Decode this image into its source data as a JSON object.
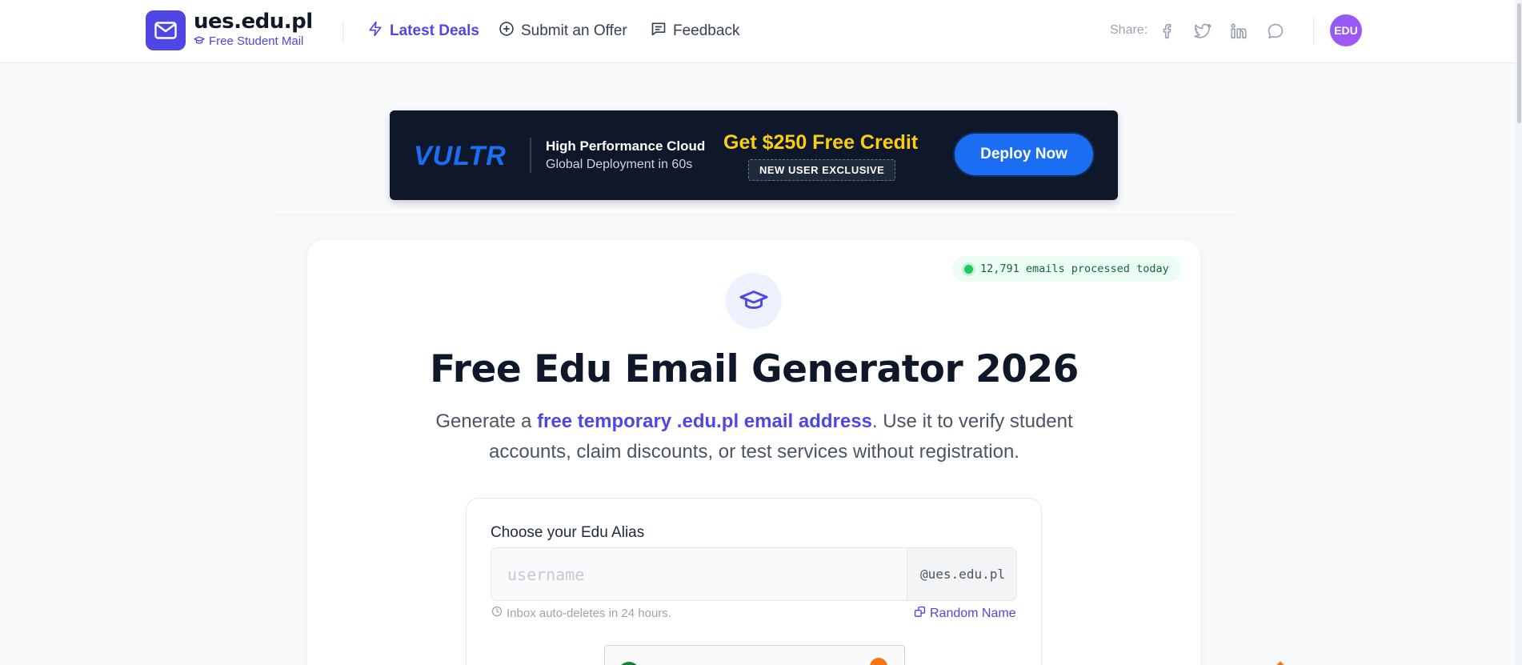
{
  "header": {
    "brand_title": "ues.edu.pl",
    "brand_subtitle": "Free Student Mail",
    "nav": [
      {
        "label": "Latest Deals",
        "icon": "lightning-icon",
        "active": true
      },
      {
        "label": "Submit an Offer",
        "icon": "plus-circle-icon",
        "active": false
      },
      {
        "label": "Feedback",
        "icon": "message-square-icon",
        "active": false
      }
    ],
    "share_label": "Share:",
    "share_icons": [
      "facebook-icon",
      "twitter-icon",
      "linkedin-icon",
      "whatsapp-icon"
    ],
    "avatar_text": "EDU"
  },
  "banner": {
    "brand": "VULTR",
    "headline": "High Performance Cloud",
    "subline": "Global Deployment in 60s",
    "credit": "Get $250 Free Credit",
    "badge": "NEW USER EXCLUSIVE",
    "cta": "Deploy Now"
  },
  "stats": {
    "emails_processed": "12,791 emails processed today"
  },
  "hero": {
    "title": "Free Edu Email Generator 2026",
    "desc_prefix": "Generate a ",
    "desc_highlight": "free temporary .edu.pl email address",
    "desc_suffix": ". Use it to verify student accounts, claim discounts, or test services without registration."
  },
  "form": {
    "label": "Choose your Edu Alias",
    "placeholder": "username",
    "value": "",
    "suffix": "@ues.edu.pl",
    "hint": "Inbox auto-deletes in 24 hours.",
    "random_label": "Random Name"
  },
  "colors": {
    "accent": "#4f46e5",
    "banner_bg": "#0f172a",
    "vultr_blue": "#1b6ef3",
    "credit_yellow": "#facc15",
    "status_green": "#22c55e"
  }
}
